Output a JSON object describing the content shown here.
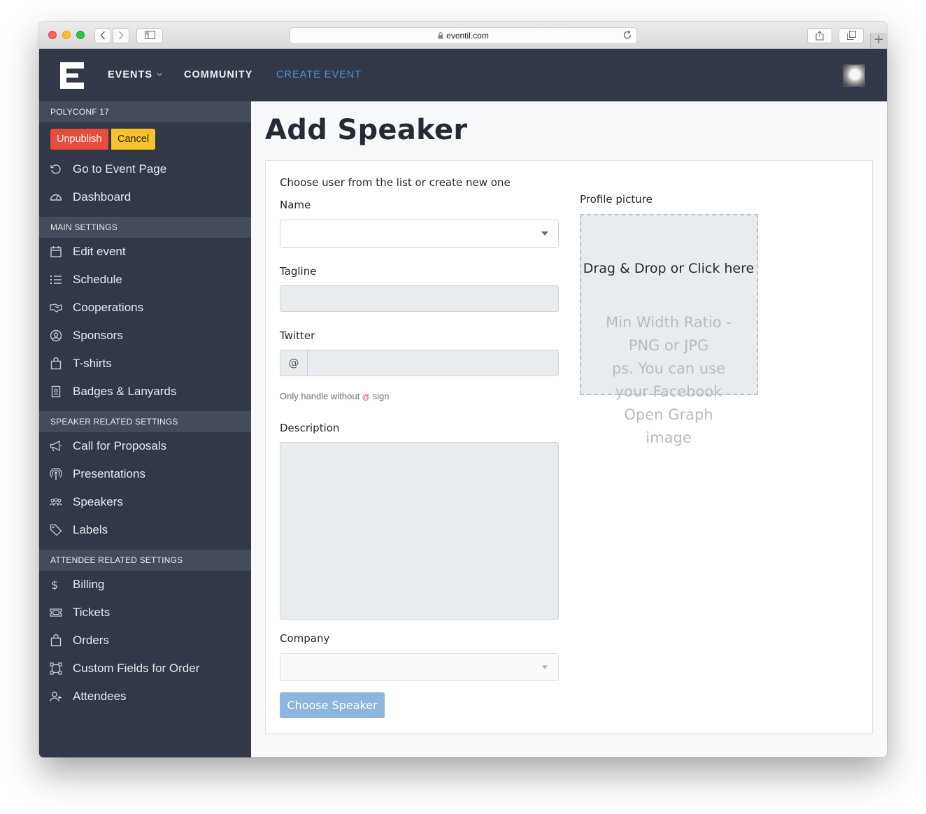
{
  "browser": {
    "url": "eventil.com"
  },
  "nav": {
    "items": [
      {
        "label": "EVENTS"
      },
      {
        "label": "COMMUNITY"
      },
      {
        "label": "CREATE EVENT"
      }
    ]
  },
  "sidebar": {
    "event_name": "POLYCONF 17",
    "unpublish_label": "Unpublish",
    "cancel_label": "Cancel",
    "top_items": [
      {
        "label": "Go to Event Page",
        "icon": "undo-icon"
      },
      {
        "label": "Dashboard",
        "icon": "dashboard-icon"
      }
    ],
    "sections": [
      {
        "heading": "MAIN SETTINGS",
        "items": [
          {
            "label": "Edit event",
            "icon": "calendar-icon"
          },
          {
            "label": "Schedule",
            "icon": "list-icon"
          },
          {
            "label": "Cooperations",
            "icon": "handshake-icon"
          },
          {
            "label": "Sponsors",
            "icon": "sponsor-icon"
          },
          {
            "label": "T-shirts",
            "icon": "bag-icon"
          },
          {
            "label": "Badges & Lanyards",
            "icon": "badge-icon"
          }
        ]
      },
      {
        "heading": "SPEAKER RELATED SETTINGS",
        "items": [
          {
            "label": "Call for Proposals",
            "icon": "megaphone-icon"
          },
          {
            "label": "Presentations",
            "icon": "podcast-icon"
          },
          {
            "label": "Speakers",
            "icon": "group-icon"
          },
          {
            "label": "Labels",
            "icon": "tags-icon"
          }
        ]
      },
      {
        "heading": "ATTENDEE RELATED SETTINGS",
        "items": [
          {
            "label": "Billing",
            "icon": "dollar-icon"
          },
          {
            "label": "Tickets",
            "icon": "ticket-icon"
          },
          {
            "label": "Orders",
            "icon": "bag-icon"
          },
          {
            "label": "Custom Fields for Order",
            "icon": "custom-fields-icon"
          },
          {
            "label": "Attendees",
            "icon": "add-user-icon"
          }
        ]
      }
    ]
  },
  "page": {
    "title": "Add Speaker"
  },
  "form": {
    "intro": "Choose user from the list or create new one",
    "name_label": "Name",
    "name_value": "",
    "tagline_label": "Tagline",
    "tagline_value": "",
    "twitter_label": "Twitter",
    "twitter_prefix": "@",
    "twitter_value": "",
    "twitter_help_before": "Only handle without ",
    "twitter_help_at": "@",
    "twitter_help_after": " sign",
    "description_label": "Description",
    "description_value": "",
    "company_label": "Company",
    "company_value": "",
    "submit_label": "Choose Speaker",
    "picture_label": "Profile picture",
    "dropzone_title": "Drag & Drop or Click here",
    "dropzone_hint_lines": [
      "Min Width Ratio -",
      "PNG or JPG",
      "ps. You can use",
      "your Facebook",
      "Open Graph",
      "image"
    ]
  },
  "colors": {
    "nav_bg": "#323848",
    "accent": "#4a90d4",
    "danger": "#e84c3d",
    "warning": "#f7c22a",
    "submit_disabled": "#8eb5dd"
  }
}
